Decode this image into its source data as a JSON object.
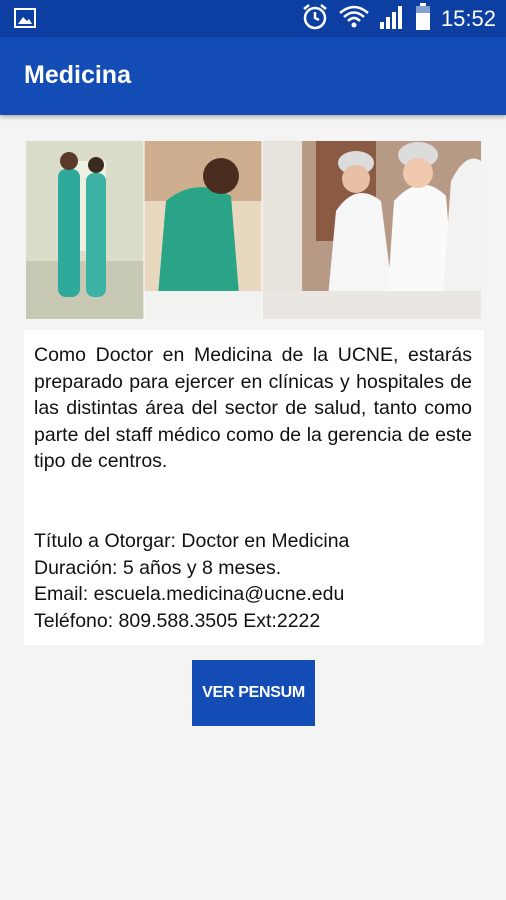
{
  "status_bar": {
    "time": "15:52",
    "icons": [
      "image-icon",
      "alarm-icon",
      "wifi-icon",
      "signal-icon",
      "battery-icon"
    ]
  },
  "app_bar": {
    "title": "Medicina"
  },
  "hero_image": {
    "description_icon": "medical-staff-photo"
  },
  "content": {
    "description": "Como Doctor en Medicina de la UCNE, estarás preparado para ejercer en clínicas y hospitales de las distintas área del sector de salud, tanto como parte del staff médico como de la gerencia de este tipo de centros.",
    "titulo": "Título a Otorgar: Doctor en Medicina",
    "duracion": "Duración: 5 años y 8 meses.",
    "email": "Email: escuela.medicina@ucne.edu",
    "telefono": "Teléfono: 809.588.3505 Ext:2222"
  },
  "button": {
    "label": "VER PENSUM"
  },
  "colors": {
    "primary": "#134cb5",
    "primary_dark": "#0d3fa3",
    "background": "#f4f4f4"
  }
}
